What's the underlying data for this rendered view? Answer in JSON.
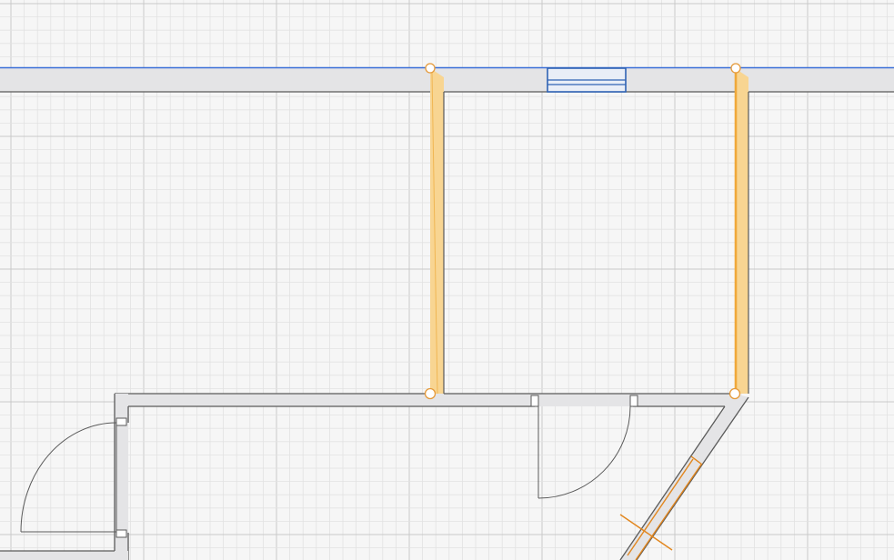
{
  "app": {
    "view": "floor-plan-editor",
    "grid": {
      "visible": true,
      "minor_spacing": 14.6,
      "major_every": 10
    }
  },
  "colors": {
    "background": "#f6f6f6",
    "grid_minor": "#e2e2e2",
    "grid_major": "#c9c9c9",
    "wall_fill": "#e4e4e6",
    "wall_stroke": "#5a5a5a",
    "selection_line": "#3b6fd8",
    "selected_wall_fill": "#f8d592",
    "selected_wall_center": "#efa83a",
    "handle_stroke": "#e59a3a",
    "window_stroke": "#2f63b4",
    "measure_line": "#e2861d"
  },
  "selection": {
    "selected_walls": 2,
    "handles": 4
  },
  "objects": {
    "window": {
      "type": "window",
      "state": "highlighted"
    },
    "doors": [
      {
        "type": "door",
        "swing": "left-wall"
      },
      {
        "type": "door",
        "swing": "interior"
      }
    ]
  }
}
